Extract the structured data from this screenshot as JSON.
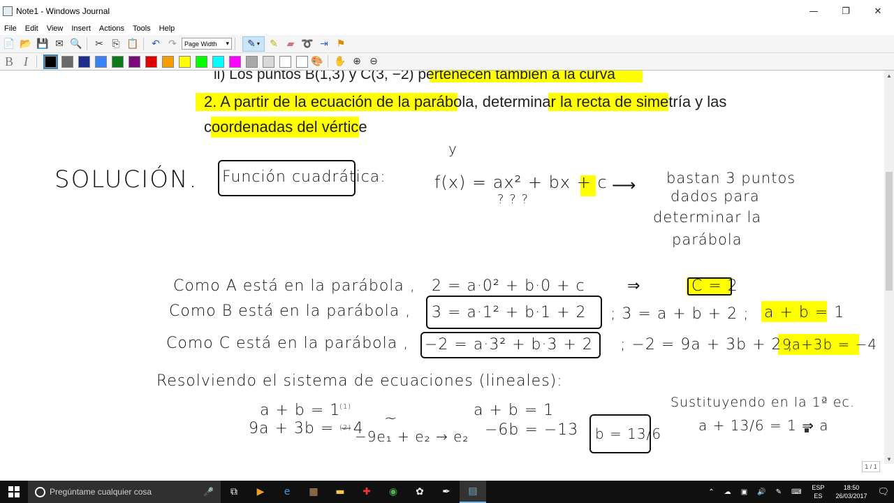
{
  "window": {
    "title": "Note1 - Windows Journal",
    "min": "—",
    "restore": "❐",
    "close": "✕"
  },
  "menu": [
    "File",
    "Edit",
    "View",
    "Insert",
    "Actions",
    "Tools",
    "Help"
  ],
  "toolbar": {
    "zoom_select": "Page Width"
  },
  "colors": [
    "#000000",
    "#6a6a6a",
    "#1e2e8a",
    "#3b82f6",
    "#0a7a1a",
    "#7a0a7a",
    "#e00000",
    "#f59e00",
    "#ffff00",
    "#00ff00",
    "#00ffff",
    "#ff00ff",
    "#a8a8a8",
    "#d8d8d8",
    "#ffffff",
    "#ffffff"
  ],
  "document": {
    "printed_line1": "ii) Los puntos B(1,3) y C(3, −2) pertenecen también a la curva",
    "printed_line2": "2. A partir de la ecuación de la parábola, determinar la recta de simetría y las",
    "printed_line3": "coordenadas del vértice",
    "handwriting": {
      "solucion": "SOLUCIÓN.",
      "funcion": "Función cuadrática:",
      "y_label": "y",
      "fx": "f(x) = ax² + bx + c",
      "qmarks": "?        ?        ?",
      "arrow": "⟶",
      "bastan1": "bastan 3 puntos",
      "bastan2": "dados para",
      "bastan3": "determinar la",
      "bastan4": "parábola",
      "como_a": "Como A está en la parábola ,",
      "como_b": "Como B está en la parábola ,",
      "como_c": "Como C está en la parábola ,",
      "eq_a": "2 = a·0² + b·0 + c",
      "implies": "⇒",
      "c_eq": "C = 2",
      "eq_b": "3 = a·1² + b·1 + 2",
      "eq_b2": "; 3 = a + b + 2 ;",
      "res_b": "a + b = 1",
      "eq_c": "−2 = a·3² + b·3 + 2",
      "eq_c2": "; −2 = 9a + 3b + 2 ;",
      "res_c": "9a+3b = −4",
      "resolviendo": "Resolviendo el sistema de ecuaciones (lineales):",
      "sys1": "a + b = 1",
      "sys1n": "(1)",
      "sys2": "9a + 3b = −4",
      "sys2n": "(2)",
      "tilde": "~",
      "op": "−9e₁ + e₂ → e₂",
      "sysb1": "a + b = 1",
      "sysb2": "−6b = −13",
      "b_res": "b = 13/6",
      "sust": "Sustituyendo en la 1ª ec.",
      "sust_eq": "a + 13/6 = 1 ⇒ a"
    }
  },
  "page_indicator": "1 / 1",
  "taskbar": {
    "search_placeholder": "Pregúntame cualquier cosa",
    "lang1": "ESP",
    "lang2": "ES",
    "time": "18:50",
    "date": "26/03/2017"
  }
}
